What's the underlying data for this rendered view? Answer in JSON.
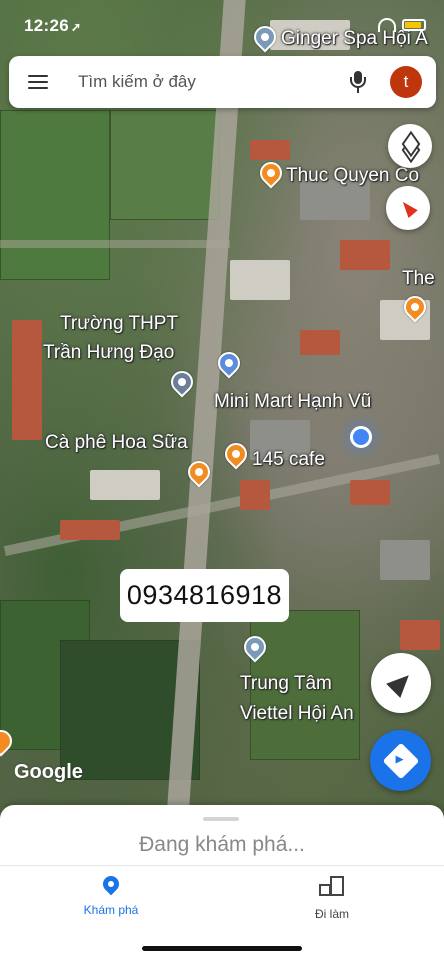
{
  "status_bar": {
    "time": "12:26",
    "location_arrow": "➚"
  },
  "search": {
    "placeholder": "Tìm kiếm ở đây",
    "avatar_initial": "t"
  },
  "map": {
    "labels": {
      "ginger_spa": "Ginger Spa Hội A",
      "thuc_quyen": "Thuc Quyen Co",
      "the": "The",
      "truong_line1": "Trường THPT",
      "truong_line2": "Trần Hưng Đạo",
      "mini_mart": "Mini Mart Hạnh Vũ",
      "ca_phe": "Cà phê Hoa Sữa",
      "cafe_145": "145 cafe",
      "viettel_line1": "Trung Tâm",
      "viettel_line2": "Viettel Hội An"
    },
    "phone_overlay": "0934816918",
    "attribution": "Google"
  },
  "bottom_sheet": {
    "status_text": "Đang khám phá..."
  },
  "nav": {
    "explore_label": "Khám phá",
    "commute_label": "Đi làm"
  },
  "colors": {
    "accent": "#1a73e8",
    "avatar": "#c0360c",
    "poi_orange": "#f28c22",
    "location_blue": "#4285f4"
  },
  "icons": [
    "menu-icon",
    "mic-icon",
    "layers-icon",
    "compass-icon",
    "my-location-icon",
    "directions-icon",
    "explore-icon",
    "commute-icon"
  ]
}
